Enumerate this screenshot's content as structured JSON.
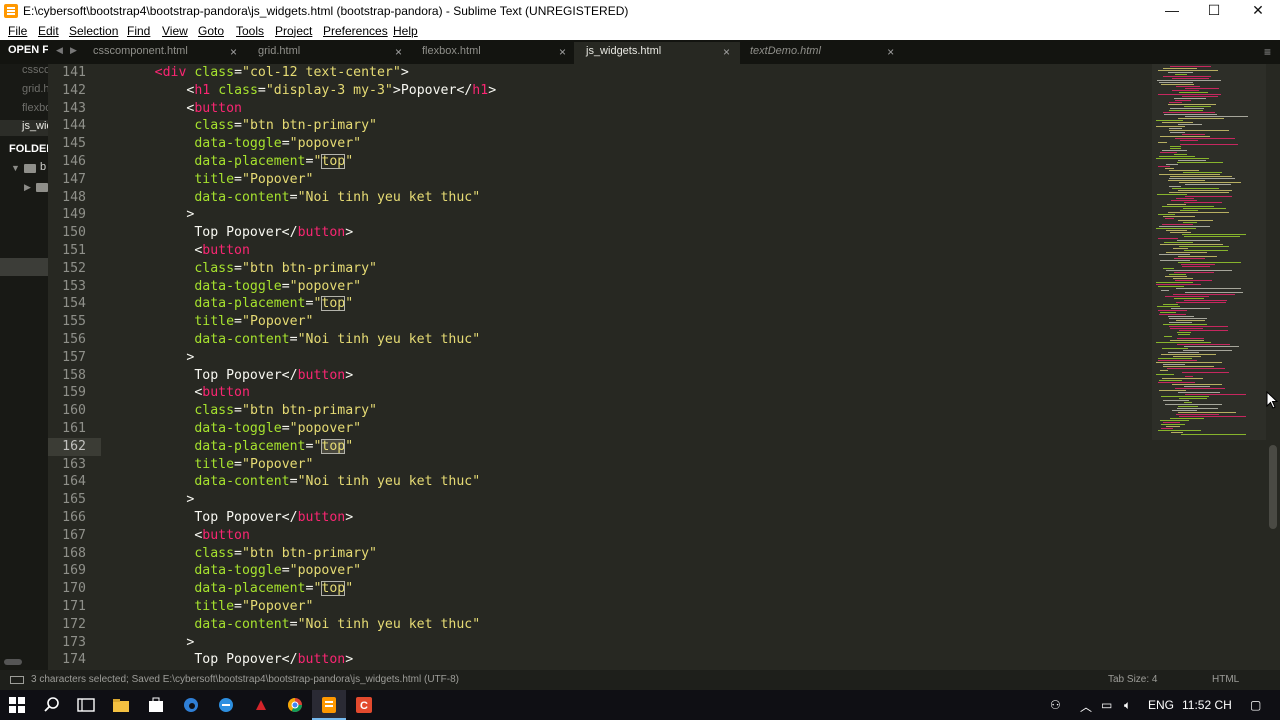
{
  "window": {
    "title": "E:\\cybersoft\\bootstrap4\\bootstrap-pandora\\js_widgets.html (bootstrap-pandora) - Sublime Text (UNREGISTERED)",
    "minimize": "—",
    "maximize": "☐",
    "close": "✕"
  },
  "menu": [
    "File",
    "Edit",
    "Selection",
    "Find",
    "View",
    "Goto",
    "Tools",
    "Project",
    "Preferences",
    "Help"
  ],
  "sidebar": {
    "open_files_label": "OPEN FI",
    "open_files": [
      "cssco",
      "grid.h",
      "flexbo",
      "js_wid"
    ],
    "folders_label": "FOLDER",
    "tree": [
      "b"
    ]
  },
  "tabs": [
    {
      "label": "csscomponent.html",
      "close": "×"
    },
    {
      "label": "grid.html",
      "close": "×"
    },
    {
      "label": "flexbox.html",
      "close": "×"
    },
    {
      "label": "js_widgets.html",
      "close": "×"
    },
    {
      "label": "textDemo.html",
      "close": "×"
    }
  ],
  "editor": {
    "current_line": 162,
    "lines": [
      {
        "n": "141",
        "code": [
          [
            "t",
            "      "
          ],
          [
            "p",
            "<div"
          ],
          [
            "t",
            " "
          ],
          [
            "g",
            "class"
          ],
          [
            "t",
            "="
          ],
          [
            "s",
            "\"col-12 text-center\""
          ],
          [
            "t",
            ">"
          ]
        ]
      },
      {
        "n": "142",
        "code": [
          [
            "t",
            "          <"
          ],
          [
            "p",
            "h1"
          ],
          [
            "t",
            " "
          ],
          [
            "g",
            "class"
          ],
          [
            "t",
            "="
          ],
          [
            "s",
            "\"display-3 my-3\""
          ],
          [
            "t",
            ">Popover</"
          ],
          [
            "p",
            "h1"
          ],
          [
            "t",
            ">"
          ]
        ]
      },
      {
        "n": "143",
        "code": [
          [
            "t",
            "          <"
          ],
          [
            "p",
            "button"
          ]
        ]
      },
      {
        "n": "144",
        "code": [
          [
            "t",
            "           "
          ],
          [
            "g",
            "class"
          ],
          [
            "t",
            "="
          ],
          [
            "s",
            "\"btn btn-primary\""
          ]
        ]
      },
      {
        "n": "145",
        "code": [
          [
            "t",
            "           "
          ],
          [
            "g",
            "data-toggle"
          ],
          [
            "t",
            "="
          ],
          [
            "s",
            "\"popover\""
          ]
        ]
      },
      {
        "n": "146",
        "code": [
          [
            "t",
            "           "
          ],
          [
            "g",
            "data-placement"
          ],
          [
            "t",
            "="
          ],
          [
            "s",
            "\""
          ],
          [
            "sb",
            "top"
          ],
          [
            "s",
            "\""
          ]
        ]
      },
      {
        "n": "147",
        "code": [
          [
            "t",
            "           "
          ],
          [
            "g",
            "title"
          ],
          [
            "t",
            "="
          ],
          [
            "s",
            "\"Popover\""
          ]
        ]
      },
      {
        "n": "148",
        "code": [
          [
            "t",
            "           "
          ],
          [
            "g",
            "data-content"
          ],
          [
            "t",
            "="
          ],
          [
            "s",
            "\"Noi tinh yeu ket thuc\""
          ]
        ]
      },
      {
        "n": "149",
        "code": [
          [
            "t",
            "          >"
          ]
        ]
      },
      {
        "n": "150",
        "code": [
          [
            "t",
            "           Top Popover</"
          ],
          [
            "p",
            "button"
          ],
          [
            "t",
            ">"
          ]
        ]
      },
      {
        "n": "151",
        "code": [
          [
            "t",
            "           <"
          ],
          [
            "p",
            "button"
          ]
        ]
      },
      {
        "n": "152",
        "code": [
          [
            "t",
            "           "
          ],
          [
            "g",
            "class"
          ],
          [
            "t",
            "="
          ],
          [
            "s",
            "\"btn btn-primary\""
          ]
        ]
      },
      {
        "n": "153",
        "code": [
          [
            "t",
            "           "
          ],
          [
            "g",
            "data-toggle"
          ],
          [
            "t",
            "="
          ],
          [
            "s",
            "\"popover\""
          ]
        ]
      },
      {
        "n": "154",
        "code": [
          [
            "t",
            "           "
          ],
          [
            "g",
            "data-placement"
          ],
          [
            "t",
            "="
          ],
          [
            "s",
            "\""
          ],
          [
            "sb",
            "top"
          ],
          [
            "s",
            "\""
          ]
        ]
      },
      {
        "n": "155",
        "code": [
          [
            "t",
            "           "
          ],
          [
            "g",
            "title"
          ],
          [
            "t",
            "="
          ],
          [
            "s",
            "\"Popover\""
          ]
        ]
      },
      {
        "n": "156",
        "code": [
          [
            "t",
            "           "
          ],
          [
            "g",
            "data-content"
          ],
          [
            "t",
            "="
          ],
          [
            "s",
            "\"Noi tinh yeu ket thuc\""
          ]
        ]
      },
      {
        "n": "157",
        "code": [
          [
            "t",
            "          >"
          ]
        ]
      },
      {
        "n": "158",
        "code": [
          [
            "t",
            "           Top Popover</"
          ],
          [
            "p",
            "button"
          ],
          [
            "t",
            ">"
          ]
        ]
      },
      {
        "n": "159",
        "code": [
          [
            "t",
            "           <"
          ],
          [
            "p",
            "button"
          ]
        ]
      },
      {
        "n": "160",
        "code": [
          [
            "t",
            "           "
          ],
          [
            "g",
            "class"
          ],
          [
            "t",
            "="
          ],
          [
            "s",
            "\"btn btn-primary\""
          ]
        ]
      },
      {
        "n": "161",
        "code": [
          [
            "t",
            "           "
          ],
          [
            "g",
            "data-toggle"
          ],
          [
            "t",
            "="
          ],
          [
            "s",
            "\"popover\""
          ]
        ]
      },
      {
        "n": "162",
        "code": [
          [
            "t",
            "           "
          ],
          [
            "g",
            "data-placement"
          ],
          [
            "t",
            "="
          ],
          [
            "s",
            "\""
          ],
          [
            "ss",
            "top"
          ],
          [
            "s",
            "\""
          ]
        ]
      },
      {
        "n": "163",
        "code": [
          [
            "t",
            "           "
          ],
          [
            "g",
            "title"
          ],
          [
            "t",
            "="
          ],
          [
            "s",
            "\"Popover\""
          ]
        ]
      },
      {
        "n": "164",
        "code": [
          [
            "t",
            "           "
          ],
          [
            "g",
            "data-content"
          ],
          [
            "t",
            "="
          ],
          [
            "s",
            "\"Noi tinh yeu ket thuc\""
          ]
        ]
      },
      {
        "n": "165",
        "code": [
          [
            "t",
            "          >"
          ]
        ]
      },
      {
        "n": "166",
        "code": [
          [
            "t",
            "           Top Popover</"
          ],
          [
            "p",
            "button"
          ],
          [
            "t",
            ">"
          ]
        ]
      },
      {
        "n": "167",
        "code": [
          [
            "t",
            "           <"
          ],
          [
            "p",
            "button"
          ]
        ]
      },
      {
        "n": "168",
        "code": [
          [
            "t",
            "           "
          ],
          [
            "g",
            "class"
          ],
          [
            "t",
            "="
          ],
          [
            "s",
            "\"btn btn-primary\""
          ]
        ]
      },
      {
        "n": "169",
        "code": [
          [
            "t",
            "           "
          ],
          [
            "g",
            "data-toggle"
          ],
          [
            "t",
            "="
          ],
          [
            "s",
            "\"popover\""
          ]
        ]
      },
      {
        "n": "170",
        "code": [
          [
            "t",
            "           "
          ],
          [
            "g",
            "data-placement"
          ],
          [
            "t",
            "="
          ],
          [
            "s",
            "\""
          ],
          [
            "sb",
            "top"
          ],
          [
            "s",
            "\""
          ]
        ]
      },
      {
        "n": "171",
        "code": [
          [
            "t",
            "           "
          ],
          [
            "g",
            "title"
          ],
          [
            "t",
            "="
          ],
          [
            "s",
            "\"Popover\""
          ]
        ]
      },
      {
        "n": "172",
        "code": [
          [
            "t",
            "           "
          ],
          [
            "g",
            "data-content"
          ],
          [
            "t",
            "="
          ],
          [
            "s",
            "\"Noi tinh yeu ket thuc\""
          ]
        ]
      },
      {
        "n": "173",
        "code": [
          [
            "t",
            "          >"
          ]
        ]
      },
      {
        "n": "174",
        "code": [
          [
            "t",
            "           Top Popover</"
          ],
          [
            "p",
            "button"
          ],
          [
            "t",
            ">"
          ]
        ]
      }
    ]
  },
  "statusbar": {
    "message": "3 characters selected; Saved E:\\cybersoft\\bootstrap4\\bootstrap-pandora\\js_widgets.html (UTF-8)",
    "tab_size": "Tab Size: 4",
    "syntax": "HTML"
  },
  "taskbar": {
    "language": "ENG",
    "clock": "11:52 CH"
  },
  "colors": {
    "tag": "#f92672",
    "attribute": "#a6e22e",
    "string": "#e6db74",
    "background": "#272822",
    "gutter": "#8f908a"
  }
}
